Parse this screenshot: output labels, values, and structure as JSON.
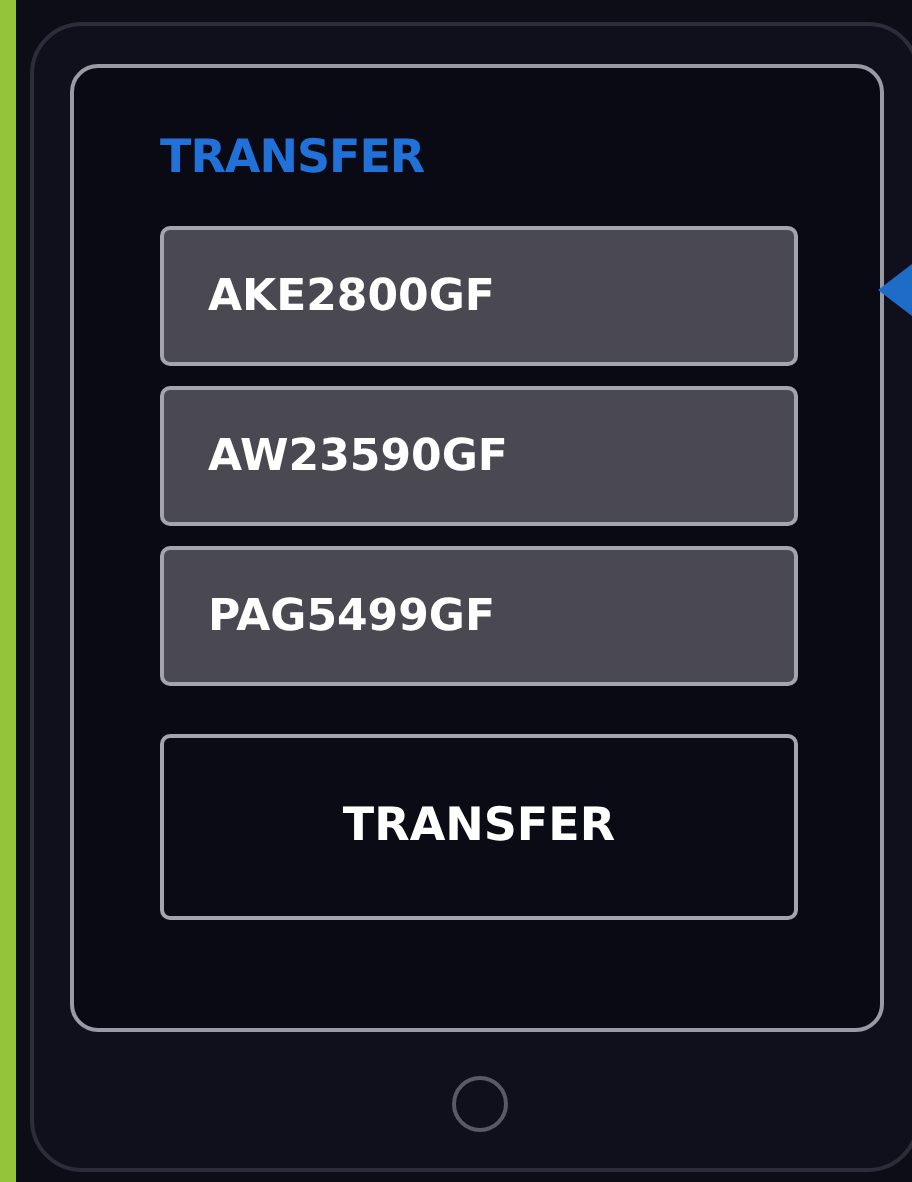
{
  "panel": {
    "title": "TRANSFER"
  },
  "codes": [
    {
      "value": "AKE2800GF"
    },
    {
      "value": "AW23590GF"
    },
    {
      "value": "PAG5499GF"
    }
  ],
  "button": {
    "label": "TRANSFER"
  }
}
